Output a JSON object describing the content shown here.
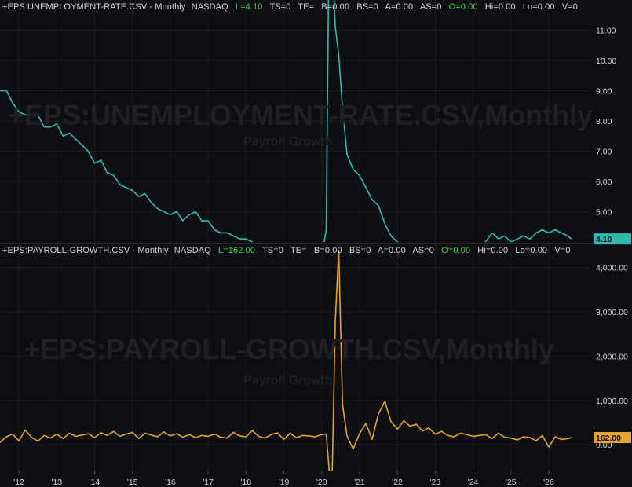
{
  "chart_data": [
    {
      "type": "line",
      "header": {
        "symbol": "+EPS:UNEMPLOYMENT-RATE.CSV - Monthly",
        "exchange": "NASDAQ",
        "fields": [
          "L=4.10",
          "TS=0",
          "TE=",
          "B=0.00",
          "BS=0",
          "A=0.00",
          "AS=0",
          "O=0.00",
          "Hi=0.00",
          "Lo=0.00",
          "V=0"
        ],
        "highlight": [
          "L=4.10",
          "O=0.00"
        ]
      },
      "watermark": "+EPS:UNEMPLOYMENT-RATE.CSV,Monthly",
      "watermark_sub": "Payroll Growth",
      "color": "#2fbcb0",
      "ylim": [
        4.0,
        12.0
      ],
      "yticks": [
        5.0,
        6.0,
        7.0,
        8.0,
        9.0,
        10.0,
        11.0
      ],
      "ytick_labels": [
        "5.00",
        "6.00",
        "7.00",
        "8.00",
        "9.00",
        "10.00",
        "11.00"
      ],
      "last_value_label": "4.10",
      "last_value": 4.1,
      "x": [
        2011.5,
        2011.67,
        2011.83,
        2012.0,
        2012.17,
        2012.33,
        2012.5,
        2012.67,
        2012.83,
        2013.0,
        2013.17,
        2013.33,
        2013.5,
        2013.67,
        2013.83,
        2014.0,
        2014.17,
        2014.33,
        2014.5,
        2014.67,
        2014.83,
        2015.0,
        2015.17,
        2015.33,
        2015.5,
        2015.67,
        2015.83,
        2016.0,
        2016.17,
        2016.33,
        2016.5,
        2016.67,
        2016.83,
        2017.0,
        2017.17,
        2017.33,
        2017.5,
        2017.67,
        2017.83,
        2018.0,
        2018.17,
        2018.33,
        2018.5,
        2018.67,
        2018.83,
        2019.0,
        2019.17,
        2019.33,
        2019.5,
        2019.67,
        2019.83,
        2020.0,
        2020.12,
        2020.2,
        2020.28,
        2020.36,
        2020.45,
        2020.55,
        2020.67,
        2020.83,
        2021.0,
        2021.17,
        2021.33,
        2021.5,
        2021.67,
        2021.83,
        2022.0,
        2022.17,
        2022.33,
        2022.5,
        2022.67,
        2022.83,
        2023.0,
        2023.17,
        2023.33,
        2023.5,
        2023.67,
        2023.83,
        2024.0,
        2024.17,
        2024.33,
        2024.5,
        2024.67,
        2024.83,
        2025.0,
        2025.17,
        2025.33,
        2025.5,
        2025.67,
        2025.83,
        2026.0,
        2026.17,
        2026.33,
        2026.5,
        2026.6
      ],
      "y": [
        9.0,
        9.0,
        8.6,
        8.3,
        8.2,
        8.2,
        8.2,
        7.8,
        7.8,
        7.9,
        7.5,
        7.6,
        7.4,
        7.2,
        7.0,
        6.6,
        6.7,
        6.3,
        6.2,
        5.9,
        5.8,
        5.7,
        5.5,
        5.6,
        5.3,
        5.1,
        5.0,
        4.9,
        5.0,
        4.7,
        4.9,
        5.0,
        4.7,
        4.7,
        4.4,
        4.3,
        4.3,
        4.2,
        4.1,
        4.1,
        4.0,
        3.8,
        3.9,
        3.7,
        3.7,
        3.9,
        3.8,
        3.6,
        3.7,
        3.5,
        3.5,
        3.5,
        4.4,
        14.8,
        13.3,
        11.1,
        10.2,
        8.4,
        6.9,
        6.4,
        6.2,
        5.8,
        5.4,
        5.2,
        4.6,
        4.2,
        4.0,
        3.6,
        3.6,
        3.5,
        3.7,
        3.5,
        3.4,
        3.6,
        3.7,
        3.5,
        3.8,
        3.7,
        3.7,
        3.9,
        4.0,
        4.3,
        4.1,
        4.2,
        4.0,
        4.1,
        4.2,
        4.1,
        4.3,
        4.4,
        4.3,
        4.4,
        4.3,
        4.2,
        4.1
      ]
    },
    {
      "type": "line",
      "header": {
        "symbol": "+EPS:PAYROLL-GROWTH.CSV - Monthly",
        "exchange": "NASDAQ",
        "fields": [
          "L=162.00",
          "TS=0",
          "TE=",
          "B=0.00",
          "BS=0",
          "A=0.00",
          "AS=0",
          "O=0.00",
          "Hi=0.00",
          "Lo=0.00",
          "V=0"
        ],
        "highlight": [
          "L=162.00",
          "O=0.00"
        ]
      },
      "watermark": "+EPS:PAYROLL-GROWTH.CSV,Monthly",
      "watermark_sub": "Payroll Growth",
      "color": "#e4a42d",
      "ylim": [
        -600,
        4400
      ],
      "yticks": [
        0,
        1000,
        2000,
        3000,
        4000
      ],
      "ytick_labels": [
        "0.00",
        "1,000.00",
        "2,000.00",
        "3,000.00",
        "4,000.00"
      ],
      "last_value_label": "162.00",
      "last_value": 162,
      "x": [
        2011.5,
        2011.67,
        2011.83,
        2012.0,
        2012.17,
        2012.33,
        2012.5,
        2012.67,
        2012.83,
        2013.0,
        2013.17,
        2013.33,
        2013.5,
        2013.67,
        2013.83,
        2014.0,
        2014.17,
        2014.33,
        2014.5,
        2014.67,
        2014.83,
        2015.0,
        2015.17,
        2015.33,
        2015.5,
        2015.67,
        2015.83,
        2016.0,
        2016.17,
        2016.33,
        2016.5,
        2016.67,
        2016.83,
        2017.0,
        2017.17,
        2017.33,
        2017.5,
        2017.67,
        2017.83,
        2018.0,
        2018.17,
        2018.33,
        2018.5,
        2018.67,
        2018.83,
        2019.0,
        2019.17,
        2019.33,
        2019.5,
        2019.67,
        2019.83,
        2020.0,
        2020.12,
        2020.2,
        2020.28,
        2020.36,
        2020.45,
        2020.55,
        2020.67,
        2020.83,
        2021.0,
        2021.17,
        2021.33,
        2021.5,
        2021.67,
        2021.83,
        2022.0,
        2022.17,
        2022.33,
        2022.5,
        2022.67,
        2022.83,
        2023.0,
        2023.17,
        2023.33,
        2023.5,
        2023.67,
        2023.83,
        2024.0,
        2024.17,
        2024.33,
        2024.5,
        2024.67,
        2024.83,
        2025.0,
        2025.17,
        2025.33,
        2025.5,
        2025.67,
        2025.83,
        2026.0,
        2026.17,
        2026.33,
        2026.5,
        2026.6
      ],
      "y": [
        50,
        180,
        240,
        90,
        330,
        170,
        80,
        210,
        150,
        240,
        140,
        260,
        190,
        220,
        250,
        160,
        270,
        210,
        300,
        190,
        240,
        280,
        140,
        260,
        220,
        180,
        290,
        200,
        250,
        170,
        230,
        160,
        210,
        190,
        240,
        170,
        150,
        280,
        200,
        180,
        320,
        190,
        150,
        230,
        270,
        120,
        260,
        160,
        210,
        200,
        180,
        230,
        240,
        -600,
        -600,
        2800,
        4400,
        900,
        200,
        -100,
        250,
        480,
        120,
        700,
        980,
        520,
        350,
        540,
        420,
        460,
        310,
        380,
        240,
        300,
        210,
        180,
        260,
        230,
        190,
        210,
        230,
        140,
        260,
        170,
        150,
        110,
        180,
        160,
        90,
        210,
        -50,
        180,
        120,
        140,
        162
      ]
    }
  ],
  "xaxis": {
    "tick_years": [
      2012,
      2013,
      2014,
      2015,
      2016,
      2017,
      2018,
      2019,
      2020,
      2021,
      2022,
      2023,
      2024,
      2025,
      2026
    ],
    "tick_labels": [
      "'12",
      "'13",
      "'14",
      "'15",
      "'16",
      "'17",
      "'18",
      "'19",
      "'20",
      "'21",
      "'22",
      "'23",
      "'24",
      "'25",
      "'26"
    ],
    "range": [
      2011.5,
      2027.1
    ]
  },
  "colors": {
    "background": "#0e0f12",
    "grid": "#1b1d22",
    "text": "#d8d8d8",
    "highlight": "#3ddc3d",
    "unemployment": "#2fbcb0",
    "payroll": "#e4a42d"
  }
}
